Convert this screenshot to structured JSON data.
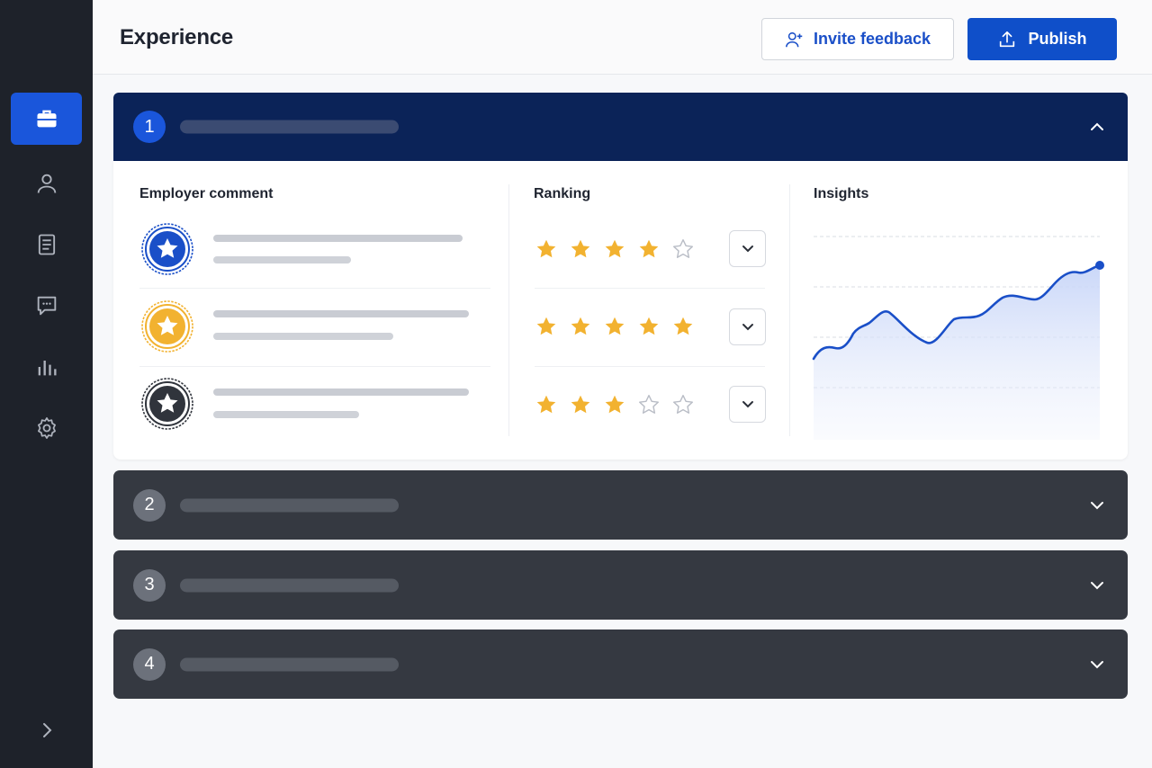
{
  "header": {
    "title": "Experience",
    "invite_label": "Invite feedback",
    "publish_label": "Publish"
  },
  "sidebar": {
    "items": [
      {
        "icon": "briefcase-icon",
        "active": true
      },
      {
        "icon": "user-icon",
        "active": false
      },
      {
        "icon": "document-icon",
        "active": false
      },
      {
        "icon": "chat-icon",
        "active": false
      },
      {
        "icon": "bar-chart-icon",
        "active": false
      },
      {
        "icon": "gear-icon",
        "active": false
      }
    ],
    "expand_icon": "chevron-right-icon"
  },
  "sections": [
    {
      "number": "1",
      "expanded": true
    },
    {
      "number": "2",
      "expanded": false
    },
    {
      "number": "3",
      "expanded": false
    },
    {
      "number": "4",
      "expanded": false
    }
  ],
  "section1": {
    "employer_comment_title": "Employer comment",
    "ranking_title": "Ranking",
    "insights_title": "Insights",
    "comments": [
      {
        "badge_color": "#1a4fc8",
        "badge": "blue-star-badge-icon"
      },
      {
        "badge_color": "#f2b230",
        "badge": "gold-star-badge-icon"
      },
      {
        "badge_color": "#30343c",
        "badge": "dark-star-badge-icon"
      }
    ],
    "rankings": [
      4,
      5,
      3
    ]
  },
  "colors": {
    "accent": "#1a56db",
    "star": "#f2b230",
    "section_open": "#0b2358",
    "section_collapsed": "#353941"
  }
}
